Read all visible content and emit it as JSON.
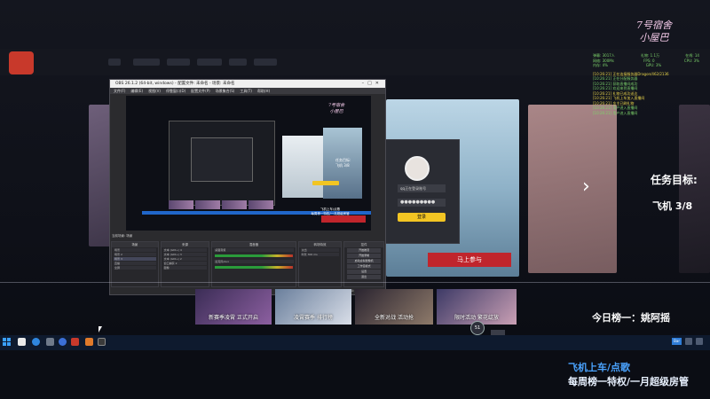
{
  "stream_overlay": {
    "stamp_line1": "7号宿舍",
    "stamp_line2": "小屋巴",
    "task_title": "任务目标:",
    "task_progress": "飞机  3/8",
    "daily_top": "今日榜一：姚阿摇",
    "promo_line1": "飞机上车/点歌",
    "promo_line2": "每周榜一特权/一月超级房管"
  },
  "background_app": {
    "join_button": "马上参与",
    "next_icon": "chevron-right-icon",
    "banners": [
      {
        "label": "新赛季凌霄 正式开启"
      },
      {
        "label": "凌霄赛季 排行榜"
      },
      {
        "label": "全新对战 活动抢"
      },
      {
        "label": "限时活动 繁花绽放"
      }
    ],
    "page_badge": "51"
  },
  "login_panel": {
    "account_value": "qq正在登录账号",
    "password_value": "●●●●●●●●●",
    "login_button": "登录"
  },
  "stats_overlay": {
    "rows": [
      [
        "弹幕: 3017人",
        "礼物: 1.1万",
        "在线: 14"
      ],
      [
        "网络: 300Ms",
        "FPS: 0",
        "CPU: 3%"
      ],
      [
        "内存: 4%",
        "GPU: 3%",
        ""
      ]
    ],
    "logs": [
      "[10:26:21] 正在连接服务器Dragon/462/2136",
      "[10:26:21] 正在分配服务器",
      "[10:26:21] 获取直播间成功",
      "[10:26:21] 欢迎来到直播间",
      "[10:26:21] 礼物已成功送达",
      "[10:26:21] 飞机上车加入直播间",
      "[10:26:21] 金主已刷礼物",
      "[10:26:21] 用户进入直播间",
      "[10:26:21] 用户进入直播间"
    ]
  },
  "obs": {
    "title": "OBS 26.1.2 (64-bit, windows) - 配置文件: 未命名 - 场景: 未命名",
    "menu": [
      "文件(F)",
      "编辑(E)",
      "视图(V)",
      "停靠窗口(D)",
      "配置文件(P)",
      "场景集合(S)",
      "工具(T)",
      "帮助(H)"
    ],
    "scene_label": "当前场景: 场景",
    "docks": {
      "scenes": {
        "title": "场景",
        "items": [
          "场景",
          "场景 2",
          "场景 3",
          "直播",
          "全屏"
        ]
      },
      "sources": {
        "title": "来源",
        "items": [
          "文本 (GDI+) 4",
          "文本 (GDI+) 3",
          "文本 (GDI+) 2",
          "窗口捕获 2",
          "图像"
        ]
      },
      "mixer": {
        "title": "混音器",
        "items": [
          "桌面音频",
          "麦克风/Aux"
        ]
      },
      "transitions": {
        "title": "转场特效",
        "items": [
          "淡出",
          "时长 300 ms"
        ]
      },
      "controls": {
        "title": "控件",
        "items": [
          "开始推流",
          "开始录制",
          "启动虚拟摄像机",
          "工作室模式",
          "设置",
          "退出"
        ]
      }
    },
    "status": "LIVE: 00:00:00   REC: 00:00:00   CPU: 2.9%, 30.00 fps"
  },
  "taskbar": {
    "start_icon": "windows-start-icon",
    "tray_badge": "Bar"
  }
}
